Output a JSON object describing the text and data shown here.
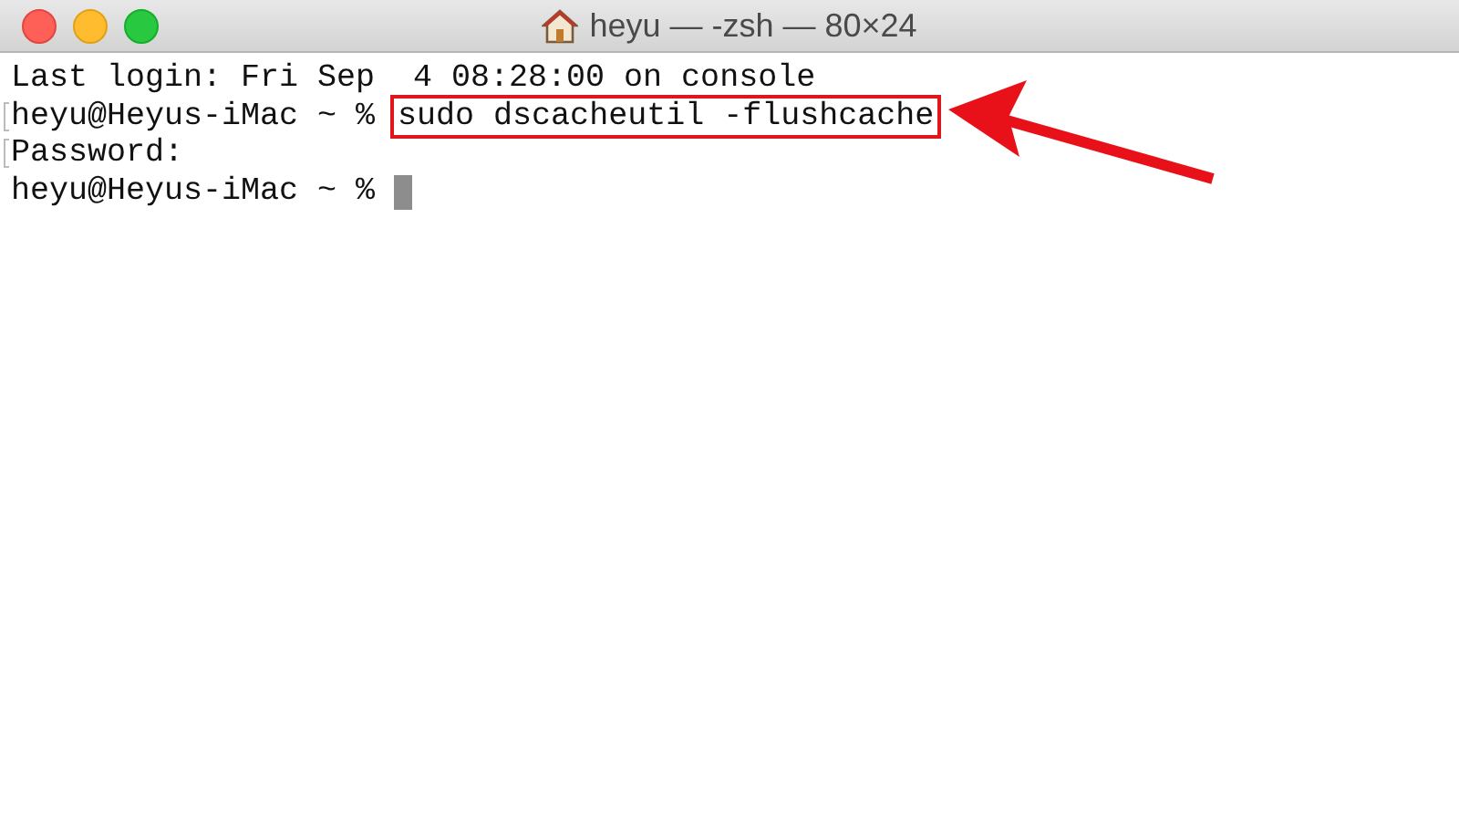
{
  "window": {
    "title": "heyu — -zsh — 80×24"
  },
  "lines": [
    {
      "kind": "output",
      "text": "Last login: Fri Sep  4 08:28:00 on console",
      "marked": false
    },
    {
      "kind": "prompt",
      "prompt": "heyu@Heyus-iMac ~ %",
      "command": "sudo dscacheutil -flushcache",
      "highlighted": true,
      "marked": true
    },
    {
      "kind": "output",
      "text": "Password:",
      "marked": true
    },
    {
      "kind": "prompt",
      "prompt": "heyu@Heyus-iMac ~ %",
      "cursor": true,
      "marked": false
    }
  ]
}
